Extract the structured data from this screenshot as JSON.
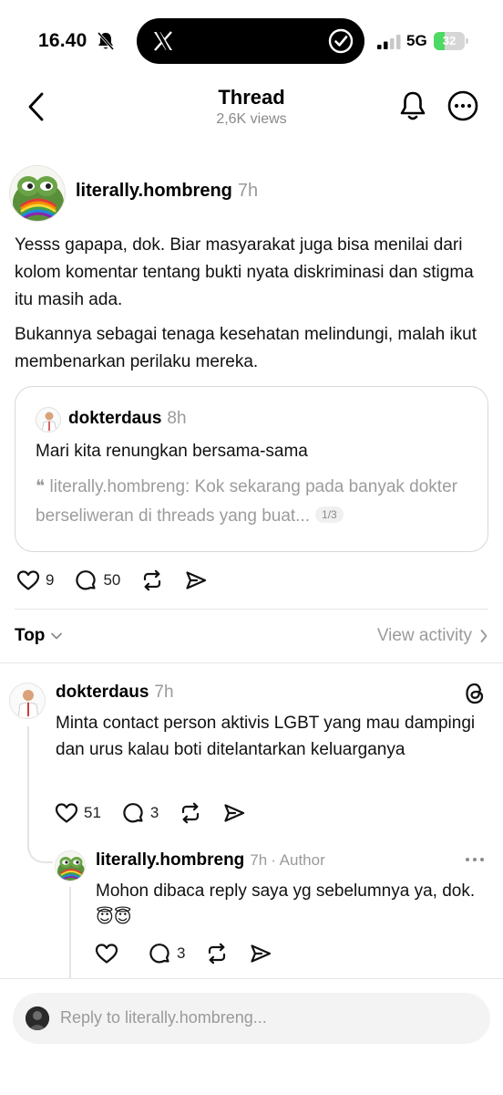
{
  "status_bar": {
    "time": "16.40",
    "network": "5G",
    "battery": "32"
  },
  "header": {
    "title": "Thread",
    "views": "2,6K views"
  },
  "post": {
    "username": "literally.hombreng",
    "time": "7h",
    "paragraphs": [
      "Yesss gapapa, dok. Biar masyarakat juga bisa menilai dari kolom komentar tentang bukti nyata diskriminasi dan stigma itu masih ada.",
      "Bukannya sebagai tenaga kesehatan melindungi, malah ikut membenarkan perilaku mereka."
    ],
    "quote": {
      "username": "dokterdaus",
      "time": "8h",
      "text": "Mari kita renungkan bersama-sama",
      "nested_quote": "❝ literally.hombreng: Kok sekarang pada banyak dokter berseliweran di threads yang buat...",
      "page_badge": "1/3"
    },
    "likes": "9",
    "replies": "50"
  },
  "sort": {
    "label": "Top",
    "view_activity": "View activity"
  },
  "replies": [
    {
      "username": "dokterdaus",
      "time": "7h",
      "text": "Minta contact person aktivis LGBT yang mau dampingi dan urus kalau boti ditelantarkan keluarganya",
      "likes": "51",
      "replies": "3"
    },
    {
      "username": "literally.hombreng",
      "time": "7h",
      "author_tag": "· Author",
      "text": "Mohon dibaca reply saya yg sebelumnya ya, dok.😇😇",
      "replies": "3"
    }
  ],
  "composer": {
    "placeholder": "Reply to literally.hombreng..."
  },
  "colors": {
    "muted_text": "#9a9a9a",
    "border": "#d8d8d8",
    "battery_green": "#4cd964"
  }
}
